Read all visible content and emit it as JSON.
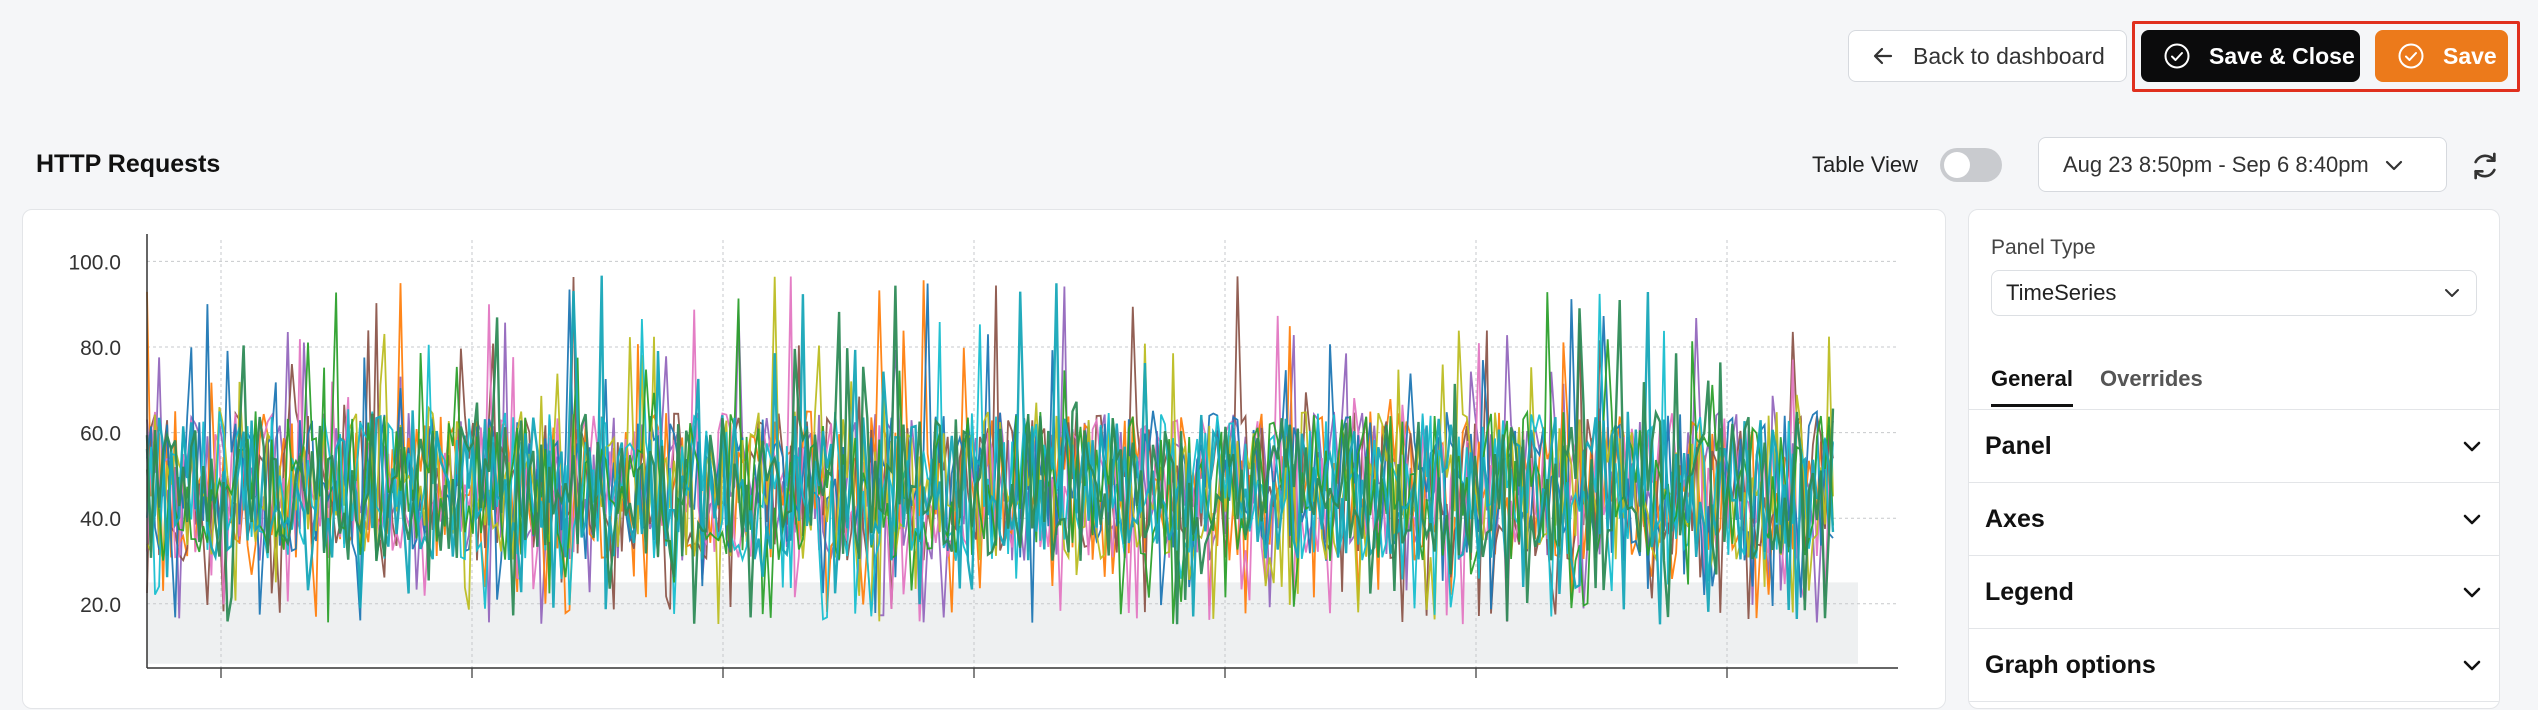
{
  "toolbar": {
    "back_label": "Back to dashboard",
    "save_close_label": "Save & Close",
    "save_label": "Save"
  },
  "panel": {
    "title": "HTTP Requests",
    "table_view_label": "Table View",
    "table_view_on": false,
    "date_range": "Aug 23 8:50pm - Sep 6 8:40pm"
  },
  "sidebar": {
    "panel_type_label": "Panel Type",
    "panel_type_value": "TimeSeries",
    "tabs": [
      {
        "label": "General"
      },
      {
        "label": "Overrides"
      }
    ],
    "sections": [
      {
        "label": "Panel"
      },
      {
        "label": "Axes"
      },
      {
        "label": "Legend"
      },
      {
        "label": "Graph options"
      }
    ]
  },
  "colors": {
    "accent_orange": "#ec7a1b",
    "highlight_red": "#e0301e",
    "series": [
      "#9467bd",
      "#ff7f0e",
      "#8c564b",
      "#e377c2",
      "#1f77b4",
      "#bcbd22",
      "#17becf",
      "#2ca02c",
      "#17a7b8",
      "#2e8b57"
    ]
  },
  "chart_data": {
    "type": "line",
    "title": "",
    "xlabel": "",
    "ylabel": "",
    "ylim": [
      5,
      105
    ],
    "yticks": [
      "100.0",
      "80.0",
      "60.0",
      "40.0",
      "20.0"
    ],
    "grid": true,
    "legend": "none",
    "series_count": 10,
    "value_range": [
      15,
      97
    ],
    "typical_band": [
      30,
      65
    ]
  }
}
